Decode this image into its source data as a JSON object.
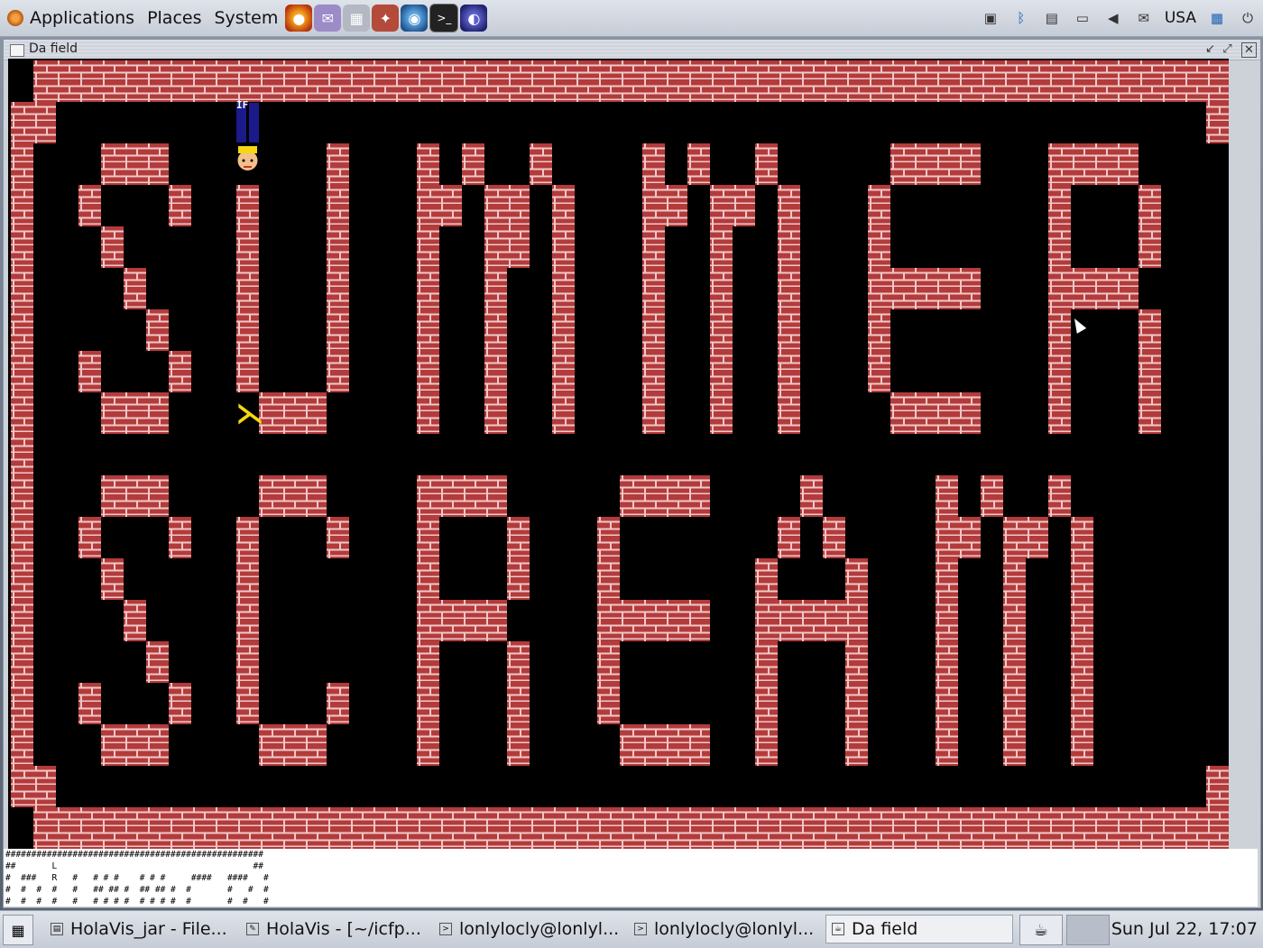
{
  "top_panel": {
    "menus": [
      "Applications",
      "Places",
      "System"
    ],
    "launchers": [
      "firefox-icon",
      "pidgin-icon",
      "network-manager-icon",
      "thunderbird-icon",
      "terminal-icon",
      "eclipse-icon"
    ],
    "tray": [
      "lock-screen-icon",
      "bluetooth-icon",
      "clipboard-icon",
      "display-icon",
      "volume-icon",
      "mail-icon"
    ],
    "keyboard_layout": "USA"
  },
  "window": {
    "title": "Da field"
  },
  "field": {
    "colors": {
      "background": "#000000",
      "brick": "#b33b3b",
      "mortar": "#f0c8c8"
    },
    "title_art": "SUMMER SCREAM",
    "robot_label": "IF",
    "lambda_symbol": "⋋"
  },
  "ascii_map": {
    "lines": [
      "##################################################",
      "##       L                                      ##",
      "#  ###   R   #   # # #    # # #     ####   ####   #",
      "#  #  #  #   #   ## ## #  ## ## #  #       #   #  #",
      "#  #  #  #   #   # # # #  # # # #  #       #  #   #"
    ]
  },
  "bottom_panel": {
    "tasks": [
      {
        "label": "HolaVis_jar - File...",
        "icon": "file-manager-icon"
      },
      {
        "label": "HolaVis - [~/icfp...",
        "icon": "editor-icon"
      },
      {
        "label": "lonlylocly@lonlyl...",
        "icon": "terminal-icon"
      },
      {
        "label": "lonlylocly@lonlyl...",
        "icon": "terminal-icon"
      },
      {
        "label": "Da field",
        "icon": "java-app-icon"
      }
    ],
    "clock": "Sun Jul 22, 17:07"
  }
}
